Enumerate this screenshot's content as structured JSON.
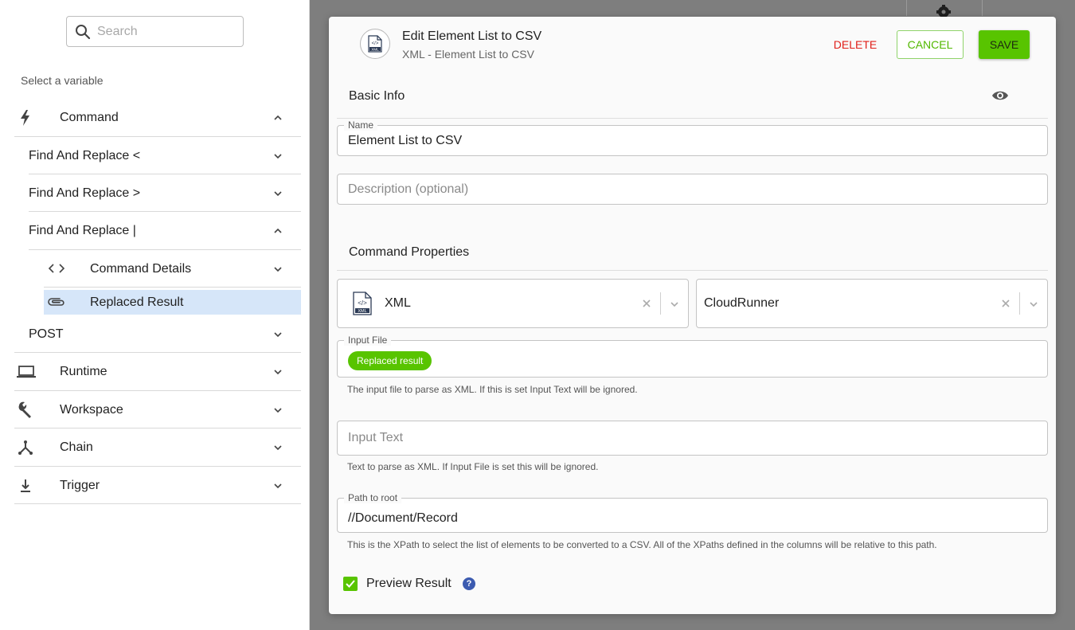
{
  "left_panel": {
    "search_placeholder": "Search",
    "select_label": "Select a variable",
    "items": {
      "command": {
        "label": "Command",
        "icon": "bolt-icon",
        "expanded": true
      },
      "find_replace_lt": {
        "label": "Find And Replace <"
      },
      "find_replace_gt": {
        "label": "Find And Replace >"
      },
      "find_replace_pipe": {
        "label": "Find And Replace |",
        "expanded": true
      },
      "command_details": {
        "label": "Command Details",
        "icon": "code-icon"
      },
      "replaced_result": {
        "label": "Replaced Result",
        "icon": "paperclip-icon",
        "selected": true
      },
      "post": {
        "label": "POST"
      },
      "runtime": {
        "label": "Runtime",
        "icon": "laptop-icon"
      },
      "workspace": {
        "label": "Workspace",
        "icon": "wrench-icon"
      },
      "chain": {
        "label": "Chain",
        "icon": "chain-fork-icon"
      },
      "trigger": {
        "label": "Trigger",
        "icon": "anchor-icon"
      }
    }
  },
  "modal": {
    "title": "Edit Element List to CSV",
    "subtitle": "XML - Element List to CSV",
    "buttons": {
      "delete": "DELETE",
      "cancel": "CANCEL",
      "save": "SAVE"
    },
    "basic_info": {
      "heading": "Basic Info",
      "name_label": "Name",
      "name_value": "Element List to CSV",
      "description_placeholder": "Description (optional)"
    },
    "command_properties": {
      "heading": "Command Properties",
      "connector": "XML",
      "runner": "CloudRunner",
      "input_file": {
        "label": "Input File",
        "chip": "Replaced result",
        "helper": "The input file to parse as XML. If this is set Input Text will be ignored."
      },
      "input_text": {
        "placeholder": "Input Text",
        "helper": "Text to parse as XML. If Input File is set this will be ignored."
      },
      "path_to_root": {
        "label": "Path to root",
        "value": "//Document/Record",
        "helper": "This is the XPath to select the list of elements to be converted to a CSV. All of the XPaths defined in the columns will be relative to this path."
      },
      "preview_result": {
        "label": "Preview Result",
        "checked": true,
        "help": "?"
      }
    }
  },
  "colors": {
    "accent_green": "#58c400",
    "delete_red": "#e0201a",
    "selected_row": "#d6e6f9",
    "backdrop": "#7e7e7e"
  }
}
